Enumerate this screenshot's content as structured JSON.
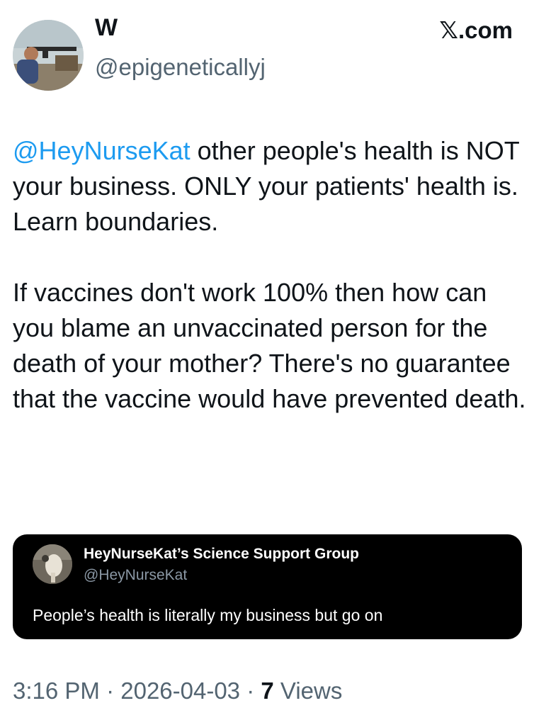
{
  "author": {
    "display_name": "W",
    "handle": "@epigeneticallyj",
    "avatar_icon": "user-avatar-photo"
  },
  "site_badge": "𝕏.com",
  "tweet": {
    "mention": "@HeyNurseKat",
    "paragraph1_rest": " other people's health is NOT your business.  ONLY your patients' health is.  Learn boundaries.",
    "paragraph2": "If vaccines don't work 100% then how can you blame an unvaccinated person for the death of your mother? There's no guarantee that the vaccine would have prevented death."
  },
  "quoted": {
    "name": "HeyNurseKat’s Science Support Group",
    "handle": "@HeyNurseKat",
    "text": "People’s health is literally my business but go on",
    "avatar_icon": "user-avatar-photo",
    "background": "#000000"
  },
  "meta": {
    "time": "3:16 PM",
    "separator": " · ",
    "date": "2026-04-03",
    "views_count": "7",
    "views_label": " Views"
  },
  "colors": {
    "mention": "#1d9bf0",
    "secondary_text": "#536471",
    "primary_text": "#0f1419"
  }
}
